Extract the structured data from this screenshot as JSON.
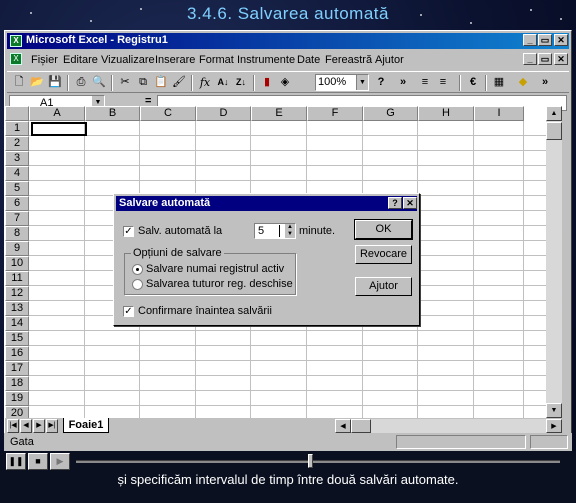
{
  "slide": {
    "title": "3.4.6. Salvarea automată",
    "caption": "și specificăm intervalul de timp între două salvări automate."
  },
  "window": {
    "title": "Microsoft Excel - Registru1",
    "minimize": "_",
    "restore": "▭",
    "close": "✕"
  },
  "menu": [
    "Fișier",
    "Editare",
    "Vizualizare",
    "Inserare",
    "Format",
    "Instrumente",
    "Date",
    "Fereastră",
    "Ajutor"
  ],
  "toolbar": {
    "zoom": "100%",
    "euro": "€"
  },
  "formula_bar": {
    "name_box": "A1",
    "equals": "="
  },
  "grid": {
    "columns": [
      "A",
      "B",
      "C",
      "D",
      "E",
      "F",
      "G",
      "H",
      "I"
    ],
    "rows": [
      "1",
      "2",
      "3",
      "4",
      "5",
      "6",
      "7",
      "8",
      "9",
      "10",
      "11",
      "12",
      "13",
      "14",
      "15",
      "16",
      "17",
      "18",
      "19",
      "20"
    ]
  },
  "sheet": {
    "tab": "Foaie1"
  },
  "status": {
    "text": "Gata"
  },
  "dialog": {
    "title": "Salvare automată",
    "help": "?",
    "close": "✕",
    "autosave_label": "Salv. automată la",
    "autosave_checked": true,
    "minutes_value": "5",
    "minutes_label": "minute.",
    "options_title": "Opțiuni de salvare",
    "option_active": "Salvare numai registrul activ",
    "option_all": "Salvarea tuturor reg. deschise",
    "selected_option": "active",
    "confirm_label": "Confirmare înaintea salvării",
    "confirm_checked": true,
    "ok": "OK",
    "cancel": "Revocare",
    "help_button": "Ajutor"
  }
}
